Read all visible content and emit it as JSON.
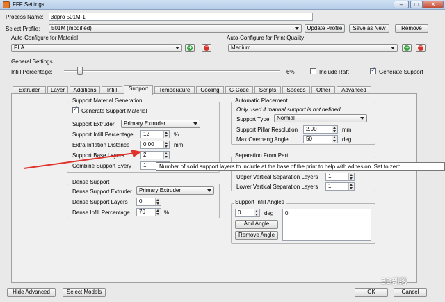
{
  "window": {
    "title": "FFF Settings",
    "min": "–",
    "max": "□",
    "close": "✕"
  },
  "process": {
    "label": "Process Name:",
    "value": "3dpro 501M-1"
  },
  "profile": {
    "label": "Select Profile:",
    "value": "501M (modified)",
    "update": "Update Profile",
    "save_as": "Save as New",
    "remove": "Remove"
  },
  "material": {
    "label": "Auto-Configure for Material",
    "value": "PLA"
  },
  "quality": {
    "label": "Auto-Configure for Print Quality",
    "value": "Medium"
  },
  "general": {
    "title": "General Settings",
    "infill_label": "Infill Percentage:",
    "infill_value": "6%",
    "infill_fraction": 0.06,
    "include_raft": "Include Raft",
    "generate_support": "Generate Support"
  },
  "tabs": [
    "Extruder",
    "Layer",
    "Additions",
    "Infill",
    "Support",
    "Temperature",
    "Cooling",
    "G-Code",
    "Scripts",
    "Speeds",
    "Other",
    "Advanced"
  ],
  "active_tab": "Support",
  "support_gen": {
    "title": "Support Material Generation",
    "generate": "Generate Support Material",
    "extruder_label": "Support Extruder",
    "extruder_value": "Primary Extruder",
    "infill_label": "Support Infill Percentage",
    "infill_value": "12",
    "infill_unit": "%",
    "inflation_label": "Extra Inflation Distance",
    "inflation_value": "0.00",
    "inflation_unit": "mm",
    "base_layers_label": "Support Base Layers",
    "base_layers_value": "2",
    "combine_label": "Combine Support Every",
    "combine_value": "1"
  },
  "tooltip": "Number of solid support layers to include at the base of the print to help with adhesion.  Set to zero",
  "dense": {
    "title": "Dense Support",
    "extruder_label": "Dense Support Extruder",
    "extruder_value": "Primary Extruder",
    "layers_label": "Dense Support Layers",
    "layers_value": "0",
    "infill_label": "Dense Infill Percentage",
    "infill_value": "70",
    "infill_unit": "%"
  },
  "auto_place": {
    "title": "Automatic Placement",
    "note": "Only used if manual support is not defined",
    "type_label": "Support Type",
    "type_value": "Normal",
    "pillar_label": "Support Pillar Resolution",
    "pillar_value": "2.00",
    "pillar_unit": "mm",
    "overhang_label": "Max Overhang Angle",
    "overhang_value": "50",
    "overhang_unit": "deg"
  },
  "separation": {
    "title": "Separation From Part",
    "upper_label": "Upper Vertical Separation Layers",
    "upper_value": "1",
    "lower_label": "Lower Vertical Separation Layers",
    "lower_value": "1"
  },
  "angles": {
    "title": "Support Infill Angles",
    "angle_value": "0",
    "angle_unit": "deg",
    "list_item": "0",
    "add": "Add Angle",
    "remove": "Remove Angle"
  },
  "bottom": {
    "hide_advanced": "Hide Advanced",
    "select_models": "Select Models",
    "ok": "OK",
    "cancel": "Cancel"
  },
  "watermark": "3D部落",
  "colors": {
    "annotation_arrow": "#e0322b",
    "titlebar": "#b6cde8"
  }
}
